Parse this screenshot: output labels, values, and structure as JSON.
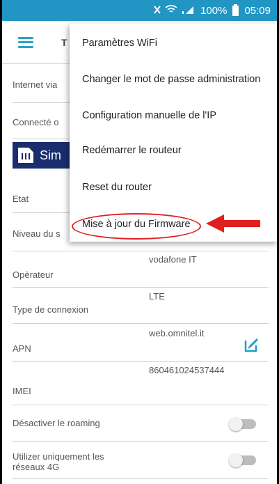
{
  "status_bar": {
    "signal_icons": "✕ ≈ .▕",
    "battery": "100%",
    "time": "05:09"
  },
  "app_bar": {
    "title_partial": "T"
  },
  "rows": {
    "internet": {
      "label": "Internet via"
    },
    "connected": {
      "label": "Connecté o"
    },
    "sim": {
      "label": "Sim"
    },
    "etat": {
      "label": "Etat"
    },
    "signal_level": {
      "label": "Niveau du s"
    },
    "operator": {
      "label": "Opèrateur",
      "value": "vodafone IT"
    },
    "connection_type": {
      "label": "Type de connexion",
      "value": "LTE"
    },
    "apn": {
      "label": "APN",
      "value": "web.omnitel.it"
    },
    "imei": {
      "label": "IMEI",
      "value": "860461024537444"
    },
    "roaming": {
      "label": "Désactiver le roaming",
      "enabled": false
    },
    "only_4g": {
      "label_line1": "Utilizer uniquement les",
      "label_line2": "réseaux 4G",
      "enabled": false
    }
  },
  "menu": {
    "items": [
      "Paramètres WiFi",
      "Changer le mot de passe administration",
      "Configuration manuelle de l'IP",
      "Redémarrer le routeur",
      "Reset du router",
      "Mise à jour du Firmware"
    ]
  },
  "colors": {
    "status_bar": "#2196c4",
    "sim_banner": "#1a2e6e",
    "accent": "#2ea3c7",
    "annotation": "#e02020"
  }
}
